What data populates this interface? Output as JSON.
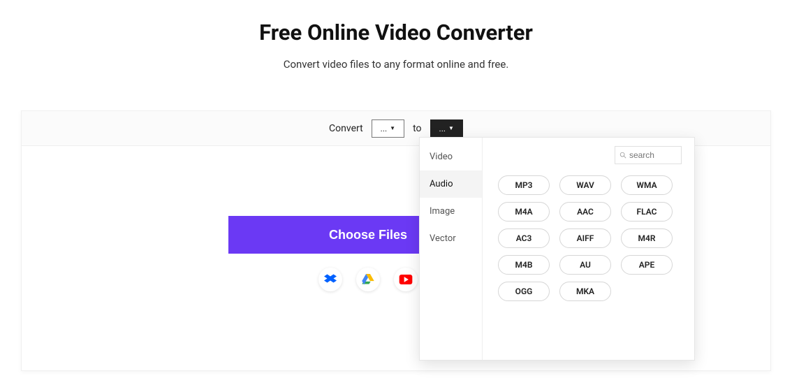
{
  "header": {
    "title": "Free Online Video Converter",
    "subtitle": "Convert video files to any format online and free."
  },
  "convertBar": {
    "label_convert": "Convert",
    "from_value": "...",
    "label_to": "to",
    "to_value": "..."
  },
  "actions": {
    "choose_label": "Choose Files"
  },
  "dropdown": {
    "search_placeholder": "search",
    "categories": [
      {
        "label": "Video",
        "active": false
      },
      {
        "label": "Audio",
        "active": true
      },
      {
        "label": "Image",
        "active": false
      },
      {
        "label": "Vector",
        "active": false
      }
    ],
    "formats": [
      "MP3",
      "WAV",
      "WMA",
      "M4A",
      "AAC",
      "FLAC",
      "AC3",
      "AIFF",
      "M4R",
      "M4B",
      "AU",
      "APE",
      "OGG",
      "MKA"
    ]
  },
  "cloud_sources": [
    "dropbox",
    "google-drive",
    "youtube"
  ]
}
